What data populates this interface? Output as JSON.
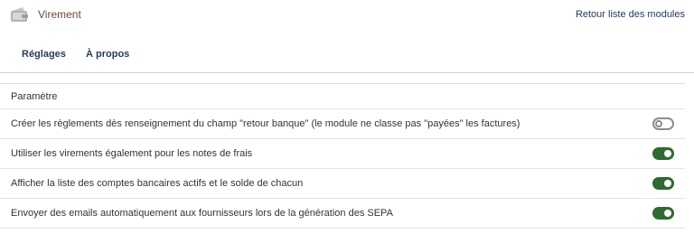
{
  "header": {
    "module_name": "Virement",
    "back_link": "Retour liste des modules"
  },
  "tabs": [
    {
      "label": "Réglages"
    },
    {
      "label": "À propos"
    }
  ],
  "table": {
    "column_header": "Paramètre",
    "rows": [
      {
        "label": "Créer les règlements dès renseignement du champ \"retour banque\" (le module ne classe pas \"payées\" les factures)",
        "enabled": false
      },
      {
        "label": "Utiliser les virements également pour les notes de frais",
        "enabled": true
      },
      {
        "label": "Afficher la liste des comptes bancaires actifs et le solde de chacun",
        "enabled": true
      },
      {
        "label": "Envoyer des emails automatiquement aux fournisseurs lors de la génération des SEPA",
        "enabled": true
      }
    ]
  },
  "colors": {
    "toggle_on": "#2e6b2e",
    "toggle_off": "#8c8c8c",
    "link": "#263c5c"
  },
  "icons": {
    "module": "wallet-icon"
  }
}
